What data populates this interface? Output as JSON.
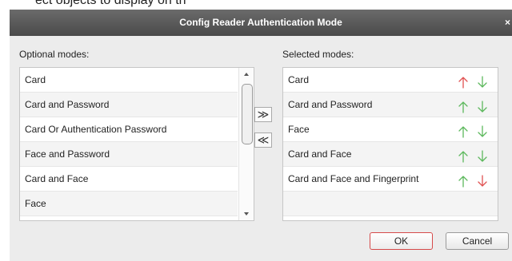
{
  "background_partial_text": "ect objects to display on th",
  "dialog": {
    "title": "Config Reader Authentication Mode",
    "close_glyph": "×",
    "optional_label": "Optional modes:",
    "selected_label": "Selected modes:",
    "optional_modes": [
      "Card",
      "Card and Password",
      "Card Or Authentication Password",
      "Face and Password",
      "Card and Face",
      "Face"
    ],
    "selected_modes": [
      {
        "label": "Card",
        "up_color": "#e05050",
        "down_color": "#5cb85c"
      },
      {
        "label": "Card and Password",
        "up_color": "#5cb85c",
        "down_color": "#5cb85c"
      },
      {
        "label": "Face",
        "up_color": "#5cb85c",
        "down_color": "#5cb85c"
      },
      {
        "label": "Card and Face",
        "up_color": "#5cb85c",
        "down_color": "#5cb85c"
      },
      {
        "label": "Card and Face and Fingerprint",
        "up_color": "#5cb85c",
        "down_color": "#e05050"
      }
    ],
    "add_glyph": "≫",
    "remove_glyph": "≪",
    "ok_label": "OK",
    "cancel_label": "Cancel"
  },
  "colors": {
    "titlebar": "#555555",
    "ok_border": "#d64a4a",
    "arrow_active_green": "#5cb85c",
    "arrow_disabled_red": "#e05050"
  }
}
